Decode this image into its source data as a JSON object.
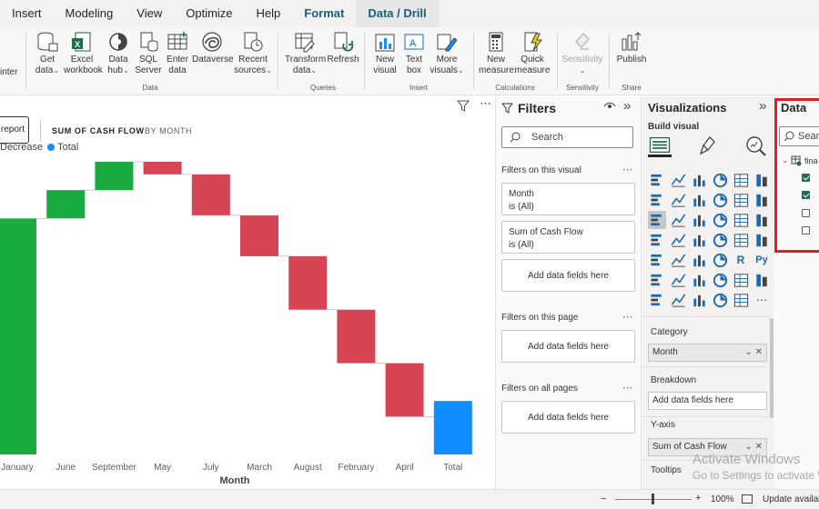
{
  "tabs": [
    {
      "label": "Insert"
    },
    {
      "label": "Modeling"
    },
    {
      "label": "View"
    },
    {
      "label": "Optimize"
    },
    {
      "label": "Help"
    },
    {
      "label": "Format"
    },
    {
      "label": "Data / Drill"
    }
  ],
  "ribbon": {
    "painter": "inter",
    "buttons": {
      "get_data": [
        "Get",
        "data"
      ],
      "excel": [
        "Excel",
        "workbook"
      ],
      "data_hub": [
        "Data",
        "hub"
      ],
      "sql": [
        "SQL",
        "Server"
      ],
      "enter": [
        "Enter",
        "data"
      ],
      "dataverse": "Dataverse",
      "recent": [
        "Recent",
        "sources"
      ],
      "transform": [
        "Transform",
        "data"
      ],
      "refresh": "Refresh",
      "new_visual": [
        "New",
        "visual"
      ],
      "text_box": [
        "Text",
        "box"
      ],
      "more_visuals": [
        "More",
        "visuals"
      ],
      "new_measure": [
        "New",
        "measure"
      ],
      "quick_measure": [
        "Quick",
        "measure"
      ],
      "sensitivity": "Sensitivity",
      "publish": "Publish"
    },
    "groups": {
      "data": "Data",
      "queries": "Queries",
      "insert": "Insert",
      "calculations": "Calculations",
      "sensitivity": "Sensitivity",
      "share": "Share"
    }
  },
  "canvas": {
    "report_button": "report",
    "chart_title": "SUM OF CASH FLOW",
    "chart_subtitle": "BY MONTH",
    "legend": {
      "decrease": "Decrease",
      "total": "Total"
    }
  },
  "chart_data": {
    "type": "waterfall",
    "xlabel": "Month",
    "categories": [
      "January",
      "June",
      "September",
      "May",
      "July",
      "March",
      "August",
      "February",
      "April",
      "Total"
    ],
    "ranges": [
      [
        0,
        75
      ],
      [
        75,
        84
      ],
      [
        84,
        93
      ],
      [
        93,
        89
      ],
      [
        89,
        76
      ],
      [
        76,
        63
      ],
      [
        63,
        46
      ],
      [
        46,
        29
      ],
      [
        29,
        12
      ],
      [
        0,
        17
      ]
    ],
    "kinds": [
      "increase",
      "increase",
      "increase",
      "decrease",
      "decrease",
      "decrease",
      "decrease",
      "decrease",
      "decrease",
      "total"
    ],
    "colors": {
      "increase": "#1aab40",
      "decrease": "#d64554",
      "total": "#118dff"
    }
  },
  "filters": {
    "title": "Filters",
    "search": "Search",
    "on_visual": "Filters on this visual",
    "on_page": "Filters on this page",
    "on_all": "Filters on all pages",
    "cards": [
      {
        "field": "Month",
        "state": "is (All)"
      },
      {
        "field": "Sum of Cash Flow",
        "state": "is (All)"
      }
    ],
    "add_fields": "Add data fields here"
  },
  "visualizations": {
    "title": "Visualizations",
    "build_visual": "Build visual",
    "category": {
      "label": "Category",
      "value": "Month"
    },
    "breakdown": {
      "label": "Breakdown",
      "placeholder": "Add data fields here"
    },
    "yaxis": {
      "label": "Y-axis",
      "value": "Sum of Cash Flow"
    },
    "tooltips": {
      "label": "Tooltips"
    }
  },
  "data_pane": {
    "title": "Data",
    "search": "Searc",
    "table": "fina"
  },
  "status": {
    "zoom": "100%",
    "update": "Update availab"
  },
  "watermark": {
    "line1": "Activate Windows",
    "line2": "Go to Settings to activate W"
  }
}
